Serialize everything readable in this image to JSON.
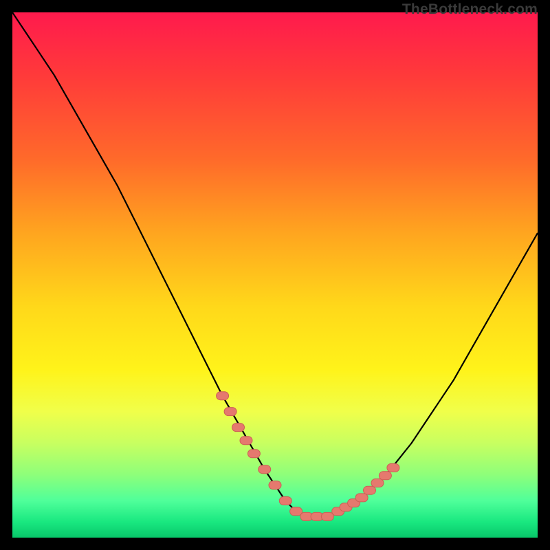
{
  "watermark": "TheBottleneck.com",
  "colors": {
    "page_bg": "#000000",
    "curve": "#000000",
    "marker_fill": "#e5796e",
    "marker_stroke": "#cc5f55"
  },
  "chart_data": {
    "type": "line",
    "title": "",
    "xlabel": "",
    "ylabel": "",
    "xlim": [
      0,
      100
    ],
    "ylim": [
      0,
      100
    ],
    "grid": false,
    "legend": false,
    "series": [
      {
        "name": "bottleneck-curve",
        "x": [
          0,
          4,
          8,
          12,
          16,
          20,
          24,
          28,
          32,
          36,
          40,
          44,
          48,
          50,
          52,
          54,
          56,
          58,
          60,
          62,
          64,
          68,
          72,
          76,
          80,
          84,
          88,
          92,
          96,
          100
        ],
        "y": [
          100,
          94,
          88,
          81,
          74,
          67,
          59,
          51,
          43,
          35,
          27,
          20,
          13,
          10,
          7,
          5,
          4,
          4,
          4,
          5,
          6,
          9,
          13,
          18,
          24,
          30,
          37,
          44,
          51,
          58
        ]
      }
    ],
    "markers": {
      "name": "highlighted-points",
      "x": [
        40,
        41.5,
        43,
        44.5,
        46,
        48,
        50,
        52,
        54,
        56,
        58,
        60,
        62,
        63.5,
        65,
        66.5,
        68,
        69.5,
        71,
        72.5
      ],
      "y": [
        27,
        24,
        21,
        18.5,
        16,
        13,
        10,
        7,
        5,
        4,
        4,
        4,
        5,
        5.8,
        6.6,
        7.6,
        9,
        10.4,
        11.8,
        13.3
      ]
    }
  }
}
